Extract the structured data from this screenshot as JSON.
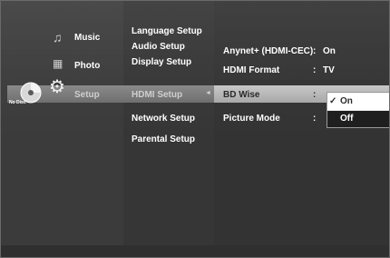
{
  "main_menu": {
    "music": "Music",
    "photo": "Photo",
    "setup": "Setup",
    "no_disc": "No Disc"
  },
  "setup_menu": {
    "items": [
      "Language Setup",
      "Audio Setup",
      "Display Setup",
      "HDMI Setup",
      "Network Setup",
      "Parental Setup"
    ]
  },
  "hdmi_menu": {
    "rows": [
      {
        "label": "Anynet+ (HDMI-CEC)",
        "value": "On"
      },
      {
        "label": "HDMI Format",
        "value": "TV"
      },
      {
        "label": "BD Wise",
        "value": ""
      },
      {
        "label": "Picture Mode",
        "value": ""
      }
    ],
    "separator": ":"
  },
  "popup": {
    "options": [
      "On",
      "Off"
    ],
    "selected": "On",
    "check": "✓"
  },
  "icons": [
    "music-icon",
    "photo-icon",
    "gear-icon",
    "disc-icon",
    "arrow-left-icon"
  ]
}
